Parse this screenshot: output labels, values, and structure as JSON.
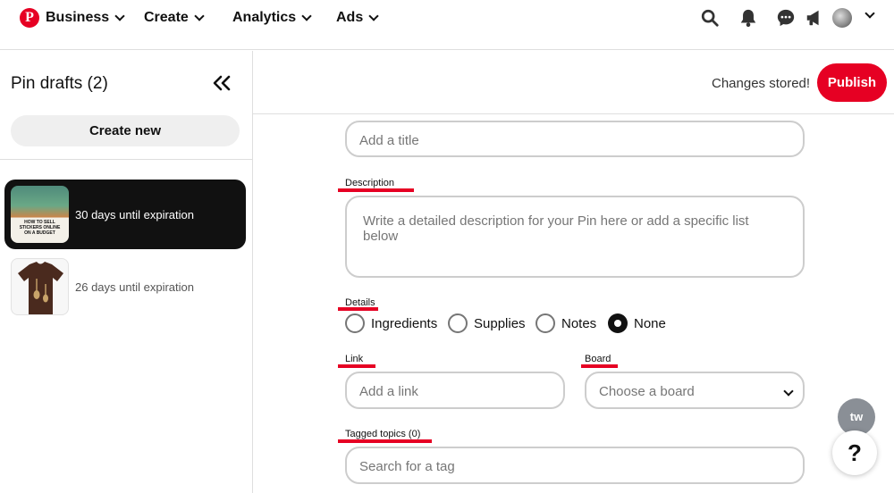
{
  "nav": {
    "logo_icon": "pinterest-logo",
    "business": "Business",
    "create": "Create",
    "analytics": "Analytics",
    "ads": "Ads",
    "accent": "#e60023"
  },
  "sidebar": {
    "title": "Pin drafts",
    "count": "(2)",
    "create_new": "Create new",
    "drafts": [
      {
        "expiration": "30 days until expiration",
        "thumb_text": "HOW TO SELL STICKERS ONLINE ON A BUDGET"
      },
      {
        "expiration": "26 days until expiration"
      }
    ]
  },
  "header": {
    "status": "Changes stored!",
    "publish": "Publish"
  },
  "form": {
    "title_placeholder": "Add a title",
    "description_label": "Description",
    "description_placeholder": "Write a detailed description for your Pin here or add a specific list below",
    "details_label": "Details",
    "details_options": [
      "Ingredients",
      "Supplies",
      "Notes",
      "None"
    ],
    "details_selected": "None",
    "link_label": "Link",
    "link_placeholder": "Add a link",
    "board_label": "Board",
    "board_placeholder": "Choose a board",
    "topics_label": "Tagged topics (0)",
    "topics_placeholder": "Search for a tag"
  },
  "widgets": {
    "help": "?",
    "tw": "tw"
  }
}
